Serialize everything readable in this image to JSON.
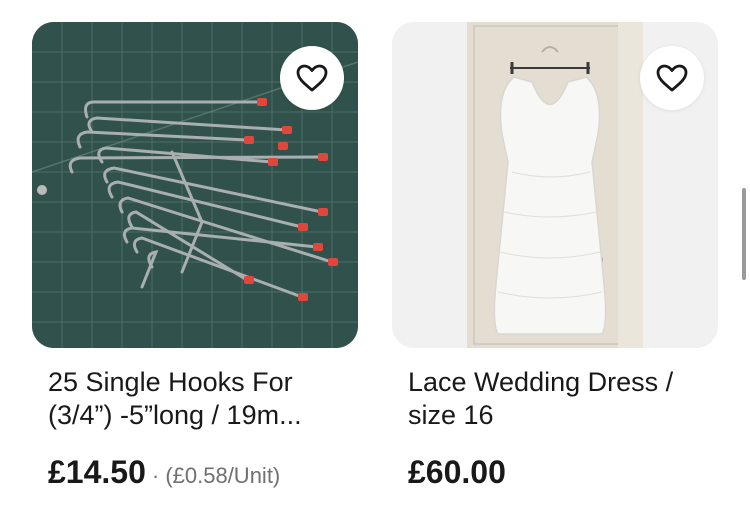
{
  "listings": [
    {
      "title": "25 Single Hooks For (3/4”) -5”long / 19m...",
      "price": "£14.50",
      "unit_price": "· (£0.58/Unit)",
      "image": "metal-pegboard-hooks-photo",
      "favorite_icon": "heart-outline-icon"
    },
    {
      "title": "Lace Wedding Dress / size 16",
      "price": "£60.00",
      "image": "white-lace-dress-photo",
      "favorite_icon": "heart-outline-icon"
    }
  ]
}
